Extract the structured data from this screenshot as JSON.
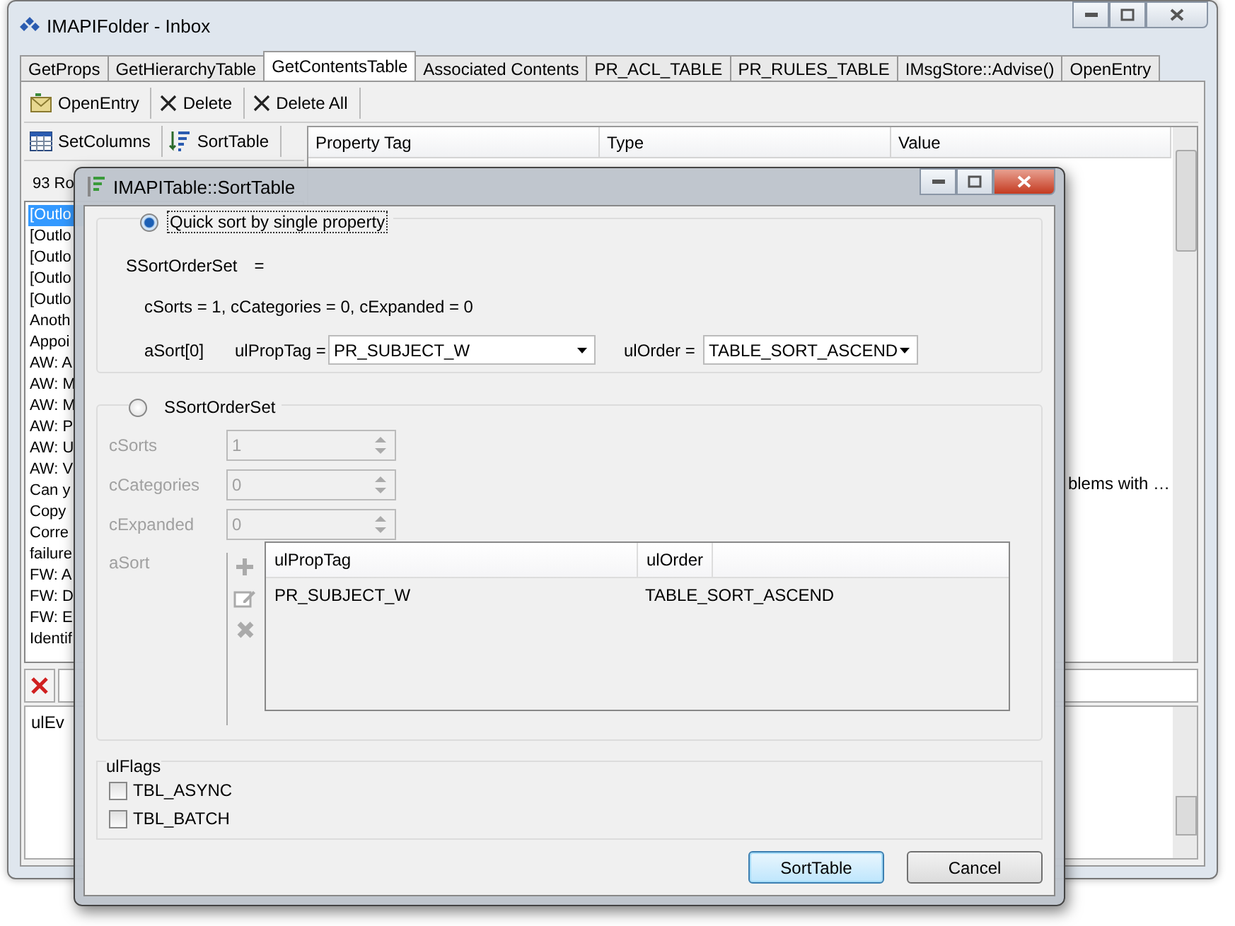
{
  "main_window": {
    "title": "IMAPIFolder - Inbox"
  },
  "tabs": [
    {
      "label": "GetProps",
      "selected": false
    },
    {
      "label": "GetHierarchyTable",
      "selected": false
    },
    {
      "label": "GetContentsTable",
      "selected": true
    },
    {
      "label": "Associated Contents",
      "selected": false
    },
    {
      "label": "PR_ACL_TABLE",
      "selected": false
    },
    {
      "label": "PR_RULES_TABLE",
      "selected": false
    },
    {
      "label": "IMsgStore::Advise()",
      "selected": false
    },
    {
      "label": "OpenEntry",
      "selected": false
    }
  ],
  "toolbar": [
    {
      "label": "OpenEntry",
      "kind": "envelope"
    },
    {
      "label": "Delete",
      "kind": "cross"
    },
    {
      "label": "Delete All",
      "kind": "cross"
    }
  ],
  "left_pane": {
    "buttons": [
      {
        "label": "SetColumns",
        "kind": "grid"
      },
      {
        "label": "SortTable",
        "kind": "sort"
      }
    ],
    "row_count": "93 Ro",
    "items": [
      {
        "text": "[Outlo",
        "selected": true
      },
      {
        "text": "[Outlo",
        "selected": false
      },
      {
        "text": "[Outlo",
        "selected": false
      },
      {
        "text": "[Outlo",
        "selected": false
      },
      {
        "text": "[Outlo",
        "selected": false
      },
      {
        "text": "Anoth",
        "selected": false
      },
      {
        "text": "Appoi",
        "selected": false
      },
      {
        "text": "AW: A",
        "selected": false
      },
      {
        "text": "AW: M",
        "selected": false
      },
      {
        "text": "AW: M",
        "selected": false
      },
      {
        "text": "AW: P",
        "selected": false
      },
      {
        "text": "AW: U",
        "selected": false
      },
      {
        "text": "AW: V",
        "selected": false
      },
      {
        "text": "Can y",
        "selected": false
      },
      {
        "text": "Copy",
        "selected": false
      },
      {
        "text": "Corre",
        "selected": false
      },
      {
        "text": "failure",
        "selected": false
      },
      {
        "text": "FW: A",
        "selected": false
      },
      {
        "text": "FW: D",
        "selected": false
      },
      {
        "text": "FW: E",
        "selected": false
      },
      {
        "text": "Identif",
        "selected": false
      }
    ]
  },
  "table": {
    "columns": [
      "Property Tag",
      "Type",
      "Value"
    ],
    "value_fragment": "blems with …"
  },
  "notifications": {
    "first_line": "ulEv"
  },
  "dialog": {
    "title": "IMAPITable::SortTable",
    "quick": {
      "label": "Quick sort by single property",
      "selected": true,
      "set_label": "SSortOrderSet",
      "equals": "=",
      "counts": "cSorts = 1, cCategories = 0, cExpanded = 0",
      "asort_label": "aSort[0]",
      "proptag_label": "ulPropTag =",
      "proptag_value": "PR_SUBJECT_W",
      "order_label": "ulOrder =",
      "order_value": "TABLE_SORT_ASCEND"
    },
    "full": {
      "label": "SSortOrderSet",
      "selected": false,
      "disabled": true,
      "fields": [
        {
          "label": "cSorts",
          "value": "1"
        },
        {
          "label": "cCategories",
          "value": "0"
        },
        {
          "label": "cExpanded",
          "value": "0"
        }
      ],
      "asort_label": "aSort",
      "columns": [
        "ulPropTag",
        "ulOrder"
      ],
      "rows": [
        [
          "PR_SUBJECT_W",
          "TABLE_SORT_ASCEND"
        ]
      ]
    },
    "flags": {
      "title": "ulFlags",
      "items": [
        {
          "label": "TBL_ASYNC",
          "checked": false
        },
        {
          "label": "TBL_BATCH",
          "checked": false
        }
      ]
    },
    "buttons": [
      {
        "label": "SortTable",
        "default": true
      },
      {
        "label": "Cancel",
        "default": false
      }
    ]
  }
}
